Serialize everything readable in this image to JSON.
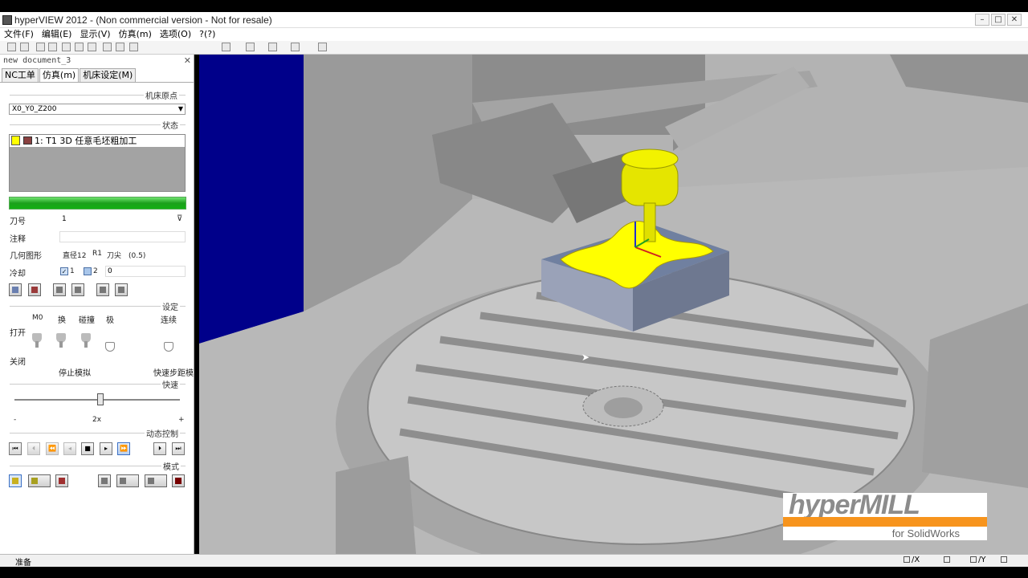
{
  "window": {
    "title": "hyperVIEW 2012 -   (Non commercial version - Not for resale)"
  },
  "menu": [
    "文件(F)",
    "编辑(E)",
    "显示(V)",
    "仿真(m)",
    "选项(O)",
    "?(?)"
  ],
  "document": {
    "title": "new document_3"
  },
  "tabs": [
    "NC工单",
    "仿真(m)",
    "机床设定(M)"
  ],
  "sections": {
    "machine_origin": "机床原点",
    "status": "状态",
    "settings": "设定",
    "speed": "快速",
    "dynamic_control": "动态控制",
    "mode": "模式"
  },
  "origin_select": {
    "value": "X0_Y0_Z200"
  },
  "status_item": {
    "text": "1: T1 3D 任意毛坯粗加工"
  },
  "progress": {
    "percent": 100
  },
  "fields": {
    "tool_label": "刀号",
    "tool_value": "1",
    "comment_label": "注释",
    "comment_value": "",
    "geometry_label": "几何图形",
    "geometry_diameter": "直径12",
    "geometry_radius": "R1",
    "geometry_tip": "刀尖　(0.5)",
    "coolant_label": "冷却",
    "coolant_1": "1",
    "coolant_2": "2",
    "coolant_value": "0"
  },
  "settings": {
    "col_m0": "M0",
    "col_change": "换",
    "col_collision": "碰撞",
    "col_limit": "极",
    "col_continuous": "连续",
    "open_label": "打开",
    "close_label": "关闭",
    "stop_sim": "停止模拟",
    "rapid_step": "快速步距模"
  },
  "speed": {
    "minus": "-",
    "value": "2x",
    "plus": "+",
    "level": 0.53
  },
  "playback_icons": [
    "first-icon",
    "prev-step-icon",
    "rewind-icon",
    "play-back-icon",
    "stop-icon",
    "play-icon",
    "fast-forward-icon",
    "next-step-icon",
    "last-icon"
  ],
  "playback_glyphs": [
    "⏮",
    "⏴",
    "⏪",
    "◂",
    "■",
    "▸",
    "⏩",
    "⏵",
    "⏭"
  ],
  "statusbar": {
    "ready": "准备",
    "ind_x": "/X",
    "ind_y": "/Y"
  },
  "logo": {
    "word": "hyperMILL",
    "sub": "for SolidWorks"
  },
  "colors": {
    "progress": "#1ca01c",
    "tool_yellow": "#ffff00",
    "viewport_bg": "#b3b3b3",
    "blue_wall": "#00008a",
    "logo_orange": "#f7941d"
  }
}
